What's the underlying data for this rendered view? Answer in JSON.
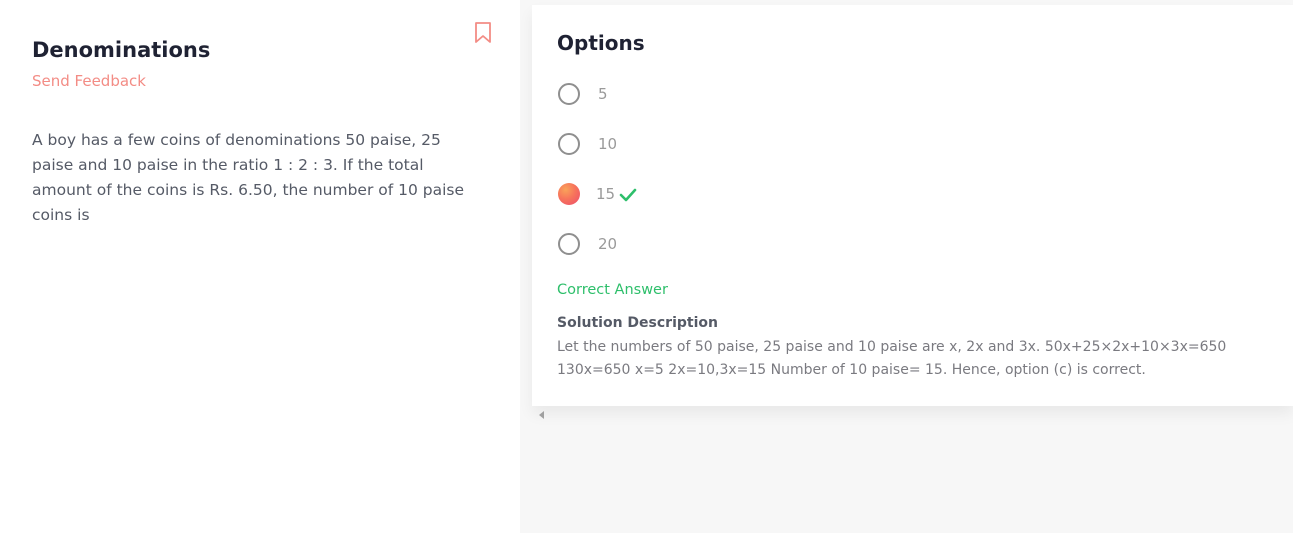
{
  "question": {
    "title": "Denominations",
    "feedback_label": "Send Feedback",
    "text": "A boy has a few coins of denominations 50 paise, 25 paise and 10 paise in the ratio 1 : 2 : 3. If the total amount of the coins is Rs. 6.50, the number of 10 paise coins is",
    "bookmark_icon": "bookmark-icon"
  },
  "options": {
    "title": "Options",
    "items": [
      {
        "label": "5",
        "selected": false
      },
      {
        "label": "10",
        "selected": false
      },
      {
        "label": "15",
        "selected": true,
        "correct": true
      },
      {
        "label": "20",
        "selected": false
      }
    ],
    "correct_label": "Correct Answer",
    "solution_heading": "Solution Description",
    "solution_text": "Let the numbers of 50 paise, 25 paise and 10 paise are x, 2x and 3x. 50x+25×2x+10×3x=650 130x=650 x=5 2x=10,3x=15 Number of 10 paise= 15. Hence, option (c) is correct."
  },
  "colors": {
    "accent": "#f38c85",
    "correct": "#2ebf6b",
    "heading": "#1f2233"
  }
}
